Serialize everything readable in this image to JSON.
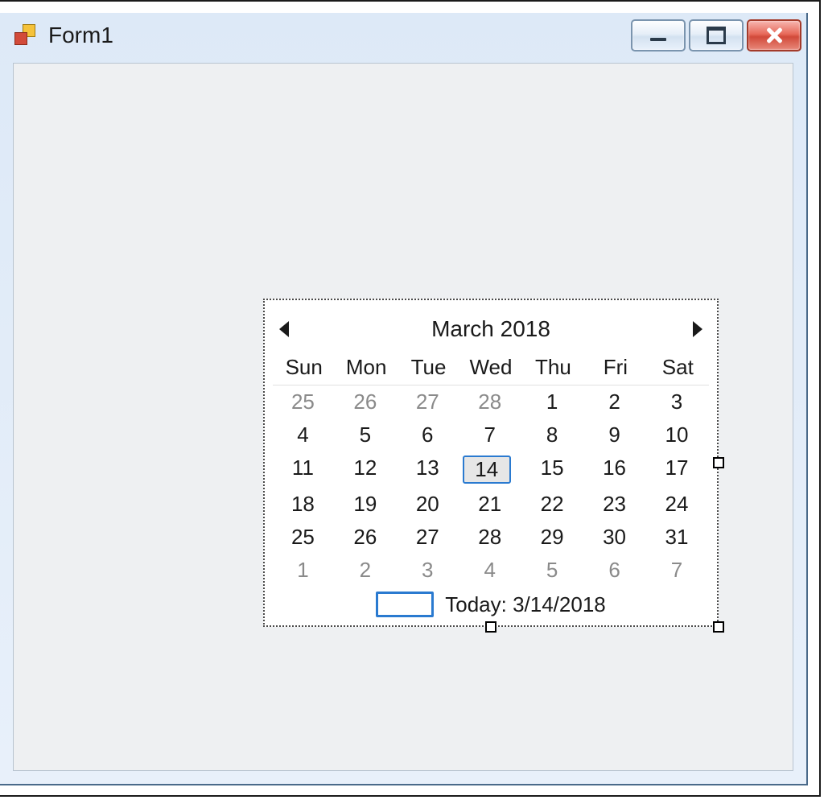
{
  "window": {
    "title": "Form1"
  },
  "caption": {
    "minimize": "Minimize",
    "maximize": "Maximize",
    "close": "Close"
  },
  "calendar": {
    "title": "March 2018",
    "day_headers": [
      "Sun",
      "Mon",
      "Tue",
      "Wed",
      "Thu",
      "Fri",
      "Sat"
    ],
    "selected_day": 14,
    "today_label": "Today: 3/14/2018",
    "weeks": [
      [
        {
          "n": 25,
          "dim": true
        },
        {
          "n": 26,
          "dim": true
        },
        {
          "n": 27,
          "dim": true
        },
        {
          "n": 28,
          "dim": true
        },
        {
          "n": 1,
          "dim": false
        },
        {
          "n": 2,
          "dim": false
        },
        {
          "n": 3,
          "dim": false
        }
      ],
      [
        {
          "n": 4,
          "dim": false
        },
        {
          "n": 5,
          "dim": false
        },
        {
          "n": 6,
          "dim": false
        },
        {
          "n": 7,
          "dim": false
        },
        {
          "n": 8,
          "dim": false
        },
        {
          "n": 9,
          "dim": false
        },
        {
          "n": 10,
          "dim": false
        }
      ],
      [
        {
          "n": 11,
          "dim": false
        },
        {
          "n": 12,
          "dim": false
        },
        {
          "n": 13,
          "dim": false
        },
        {
          "n": 14,
          "dim": false
        },
        {
          "n": 15,
          "dim": false
        },
        {
          "n": 16,
          "dim": false
        },
        {
          "n": 17,
          "dim": false
        }
      ],
      [
        {
          "n": 18,
          "dim": false
        },
        {
          "n": 19,
          "dim": false
        },
        {
          "n": 20,
          "dim": false
        },
        {
          "n": 21,
          "dim": false
        },
        {
          "n": 22,
          "dim": false
        },
        {
          "n": 23,
          "dim": false
        },
        {
          "n": 24,
          "dim": false
        }
      ],
      [
        {
          "n": 25,
          "dim": false
        },
        {
          "n": 26,
          "dim": false
        },
        {
          "n": 27,
          "dim": false
        },
        {
          "n": 28,
          "dim": false
        },
        {
          "n": 29,
          "dim": false
        },
        {
          "n": 30,
          "dim": false
        },
        {
          "n": 31,
          "dim": false
        }
      ],
      [
        {
          "n": 1,
          "dim": true
        },
        {
          "n": 2,
          "dim": true
        },
        {
          "n": 3,
          "dim": true
        },
        {
          "n": 4,
          "dim": true
        },
        {
          "n": 5,
          "dim": true
        },
        {
          "n": 6,
          "dim": true
        },
        {
          "n": 7,
          "dim": true
        }
      ]
    ]
  }
}
